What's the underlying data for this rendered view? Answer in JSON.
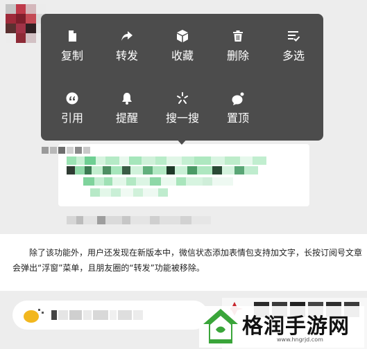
{
  "context_menu": {
    "row1": [
      {
        "label": "复制",
        "icon": "copy-icon"
      },
      {
        "label": "转发",
        "icon": "forward-icon"
      },
      {
        "label": "收藏",
        "icon": "favorite-box-icon"
      },
      {
        "label": "删除",
        "icon": "trash-icon"
      },
      {
        "label": "多选",
        "icon": "multi-select-icon"
      }
    ],
    "row2": [
      {
        "label": "引用",
        "icon": "quote-icon"
      },
      {
        "label": "提醒",
        "icon": "bell-icon"
      },
      {
        "label": "搜一搜",
        "icon": "sparkle-search-icon"
      },
      {
        "label": "置顶",
        "icon": "pin-top-icon"
      }
    ]
  },
  "article": {
    "text": "除了该功能外，用户还发现在新版本中，微信状态添加表情包支持加文字，长按订阅号文章会弹出“浮窗”菜单，且朋友圈的“转发”功能被移除。"
  },
  "watermark": {
    "title": "格润手游网",
    "url": "www.hngrjd.com"
  },
  "colors": {
    "menu_bg": "#4c4c4c",
    "panel_bg": "#ededed",
    "mosaic_green": "#2c9a5a",
    "logo_green": "#3aa53a"
  }
}
